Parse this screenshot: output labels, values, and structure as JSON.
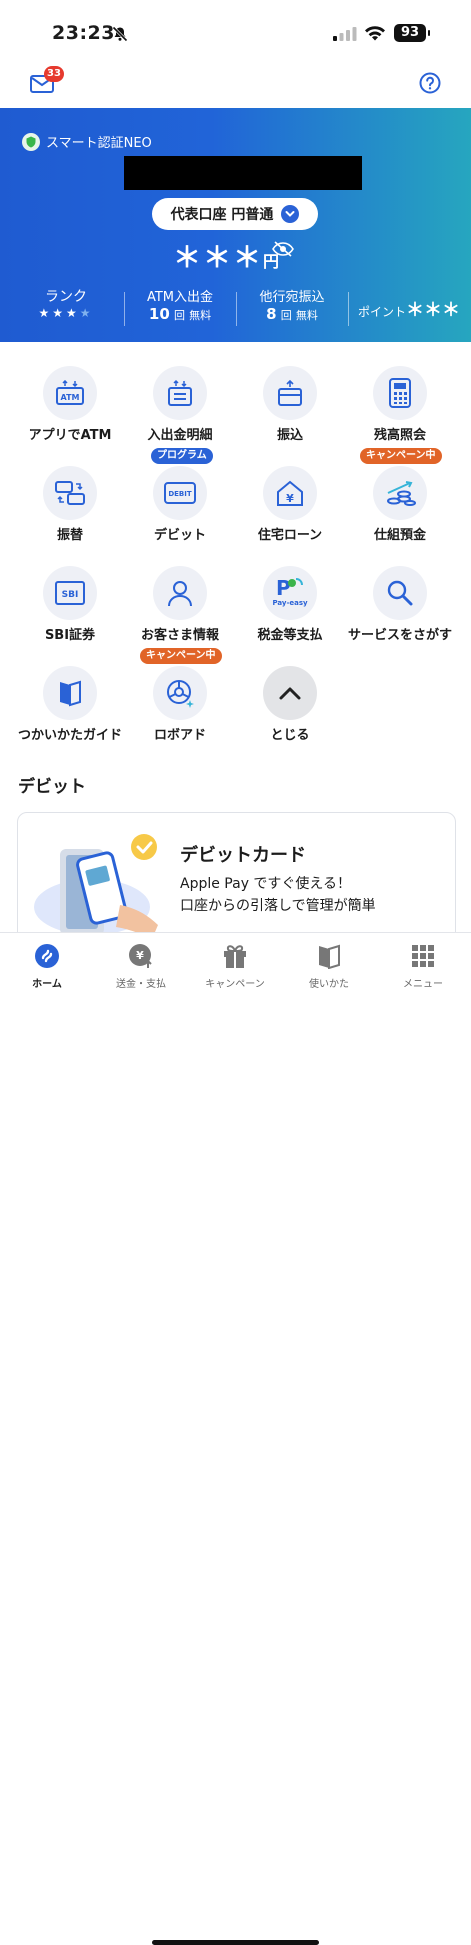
{
  "status_bar": {
    "time": "23:23",
    "battery": "93"
  },
  "topbar": {
    "mail_badge": "33"
  },
  "hero": {
    "auth_label": "スマート認証NEO",
    "account_selector": "代表口座 円普通",
    "balance_mask": "＊＊＊",
    "balance_unit": "円",
    "rank_label": "ランク",
    "rank_stars_filled": 3,
    "rank_stars_total": 4,
    "atm_label": "ATM入出金",
    "atm_count": "10",
    "atm_unit": "回",
    "atm_free": "無料",
    "transfer_label": "他行宛振込",
    "transfer_count": "8",
    "transfer_unit": "回",
    "transfer_free": "無料",
    "points_label": "ポイント",
    "points_mask": "＊＊＊"
  },
  "menu": [
    {
      "label": "アプリでATM",
      "icon": "atm-icon"
    },
    {
      "label": "入出金明細",
      "icon": "statement-icon"
    },
    {
      "label": "振込",
      "icon": "transfer-icon"
    },
    {
      "label": "残高照会",
      "icon": "calculator-icon"
    },
    {
      "label": "振替",
      "icon": "swap-cards-icon"
    },
    {
      "label": "デビット",
      "icon": "debit-card-icon",
      "tag": "プログラム"
    },
    {
      "label": "住宅ローン",
      "icon": "house-yen-icon"
    },
    {
      "label": "仕組預金",
      "icon": "coins-growth-icon",
      "tag": "キャンペーン中"
    },
    {
      "label": "SBI証券",
      "icon": "sbi-icon"
    },
    {
      "label": "お客さま情報",
      "icon": "person-icon"
    },
    {
      "label": "税金等支払",
      "icon": "pay-easy-icon"
    },
    {
      "label": "サービスをさがす",
      "icon": "search-icon"
    },
    {
      "label": "つかいかたガイド",
      "icon": "guide-book-icon"
    },
    {
      "label": "ロボアド",
      "icon": "robo-advisor-icon",
      "tag": "キャンペーン中"
    },
    {
      "label": "とじる",
      "icon": "chevron-up-icon"
    }
  ],
  "pay_easy_text": "Pay-easy",
  "debit_section": {
    "title": "デビット",
    "card_title": "デビットカード",
    "line1": "Apple Pay ですぐ使える！",
    "line2": "口座からの引落しで管理が簡単"
  },
  "tabbar": [
    {
      "label": "ホーム",
      "icon": "home-icon",
      "active": true
    },
    {
      "label": "送金・支払",
      "icon": "yen-send-icon",
      "active": false
    },
    {
      "label": "キャンペーン",
      "icon": "gift-icon",
      "active": false
    },
    {
      "label": "使いかた",
      "icon": "guide-icon",
      "active": false
    },
    {
      "label": "メニュー",
      "icon": "grid-menu-icon",
      "active": false
    }
  ],
  "colors": {
    "primary": "#2a62d6",
    "tag_orange": "#e16428",
    "badge_red": "#e63a2e"
  }
}
